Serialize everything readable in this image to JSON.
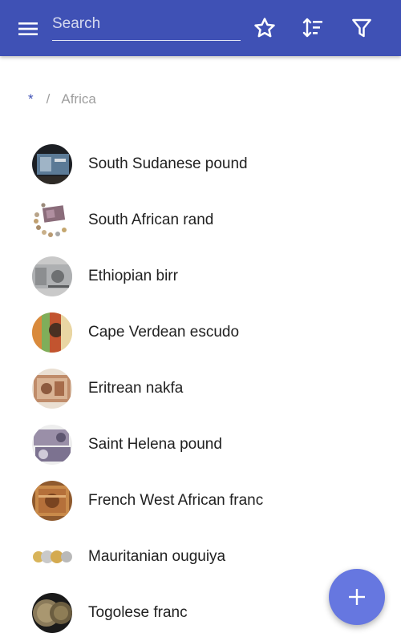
{
  "header": {
    "search": {
      "placeholder": "Search",
      "value": ""
    },
    "icons": [
      "menu-icon",
      "star-icon",
      "sort-icon",
      "filter-icon"
    ]
  },
  "breadcrumb": {
    "root": "*",
    "separator": "/",
    "current": "Africa"
  },
  "items": [
    {
      "label": "South Sudanese pound"
    },
    {
      "label": "South African rand"
    },
    {
      "label": "Ethiopian birr"
    },
    {
      "label": "Cape Verdean escudo"
    },
    {
      "label": "Eritrean nakfa"
    },
    {
      "label": "Saint Helena pound"
    },
    {
      "label": "French West African franc"
    },
    {
      "label": "Mauritanian ouguiya"
    },
    {
      "label": "Togolese franc"
    }
  ],
  "fab": {
    "icon": "plus-icon"
  },
  "colors": {
    "appbar": "#3f51b5",
    "fab": "#6677e0",
    "accent": "#3f51b5"
  }
}
